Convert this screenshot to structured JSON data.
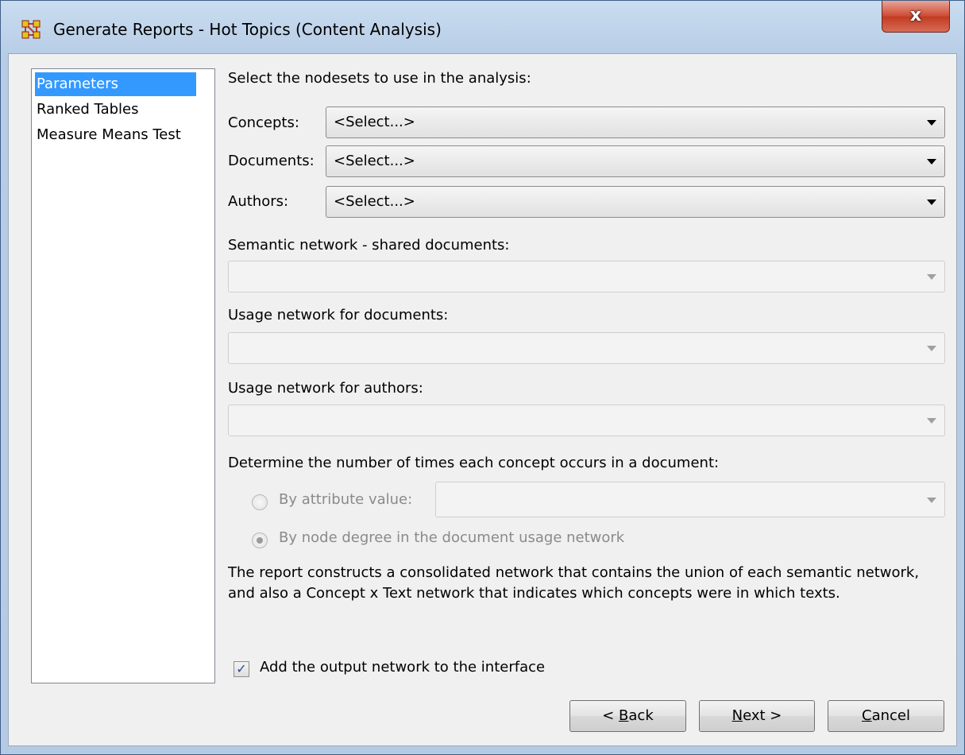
{
  "window": {
    "title": "Generate Reports - Hot Topics (Content Analysis)",
    "close_label": "x",
    "app_icon": "ora-network-icon"
  },
  "nav": {
    "items": [
      {
        "label": "Parameters",
        "selected": true
      },
      {
        "label": "Ranked Tables",
        "selected": false
      },
      {
        "label": "Measure Means Test",
        "selected": false
      }
    ]
  },
  "params": {
    "heading": "Select the nodesets to use in the analysis:",
    "concepts_label": "Concepts:",
    "concepts_value": "<Select...>",
    "documents_label": "Documents:",
    "documents_value": "<Select...>",
    "authors_label": "Authors:",
    "authors_value": "<Select...>",
    "semantic_label": "Semantic network - shared documents:",
    "semantic_value": "",
    "usage_docs_label": "Usage network for documents:",
    "usage_docs_value": "",
    "usage_authors_label": "Usage network for authors:",
    "usage_authors_value": "",
    "occurrence_heading": "Determine the number of times each concept occurs in a document:",
    "by_attribute_label": "By attribute value:",
    "by_attribute_value": "",
    "by_degree_label": "By node degree in the document usage network",
    "by_degree_selected": true,
    "description": "The report constructs a consolidated network that contains the union of each semantic network, and also a Concept x Text network that indicates which concepts were in which texts.",
    "add_output_label": "Add the output network to the interface",
    "add_output_checked": true
  },
  "buttons": {
    "back_prefix": "< ",
    "back_mnemonic": "B",
    "back_rest": "ack",
    "next_mnemonic": "N",
    "next_rest": "ext >",
    "cancel_mnemonic": "C",
    "cancel_rest": "ancel"
  },
  "colors": {
    "selection": "#3399ff",
    "title_bar": "#c9dcf0",
    "close_button": "#cd4a33"
  }
}
